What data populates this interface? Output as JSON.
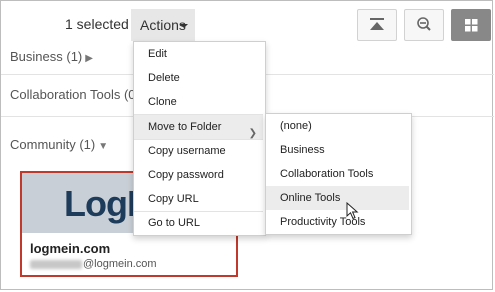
{
  "toolbar": {
    "selected_count": "1 selected",
    "actions_label": "Actions",
    "icons": [
      "collapse-top-icon",
      "zoom-out-icon",
      "grid-view-icon"
    ]
  },
  "groups": [
    {
      "label": "Business (1)",
      "state": "collapsed"
    },
    {
      "label": "Collaboration Tools (0)",
      "state": "collapsed"
    },
    {
      "label": "Community (1)",
      "state": "expanded"
    }
  ],
  "card": {
    "logo_text": "LogMeIn",
    "site_name": "logmein.com",
    "username_suffix": "@logmein.com"
  },
  "actions_menu": {
    "items": [
      "Edit",
      "Delete",
      "Clone",
      "Move to Folder",
      "Copy username",
      "Copy password",
      "Copy URL",
      "Go to URL"
    ],
    "highlighted": "Move to Folder"
  },
  "folder_menu": {
    "items": [
      "(none)",
      "Business",
      "Collaboration Tools",
      "Online Tools",
      "Productivity Tools"
    ],
    "highlighted": "Online Tools"
  },
  "colors": {
    "card_border": "#c0392b",
    "logo": "#1d3b5a",
    "banner": "#c9cfd6",
    "actions_bg": "#e7e7e7"
  }
}
